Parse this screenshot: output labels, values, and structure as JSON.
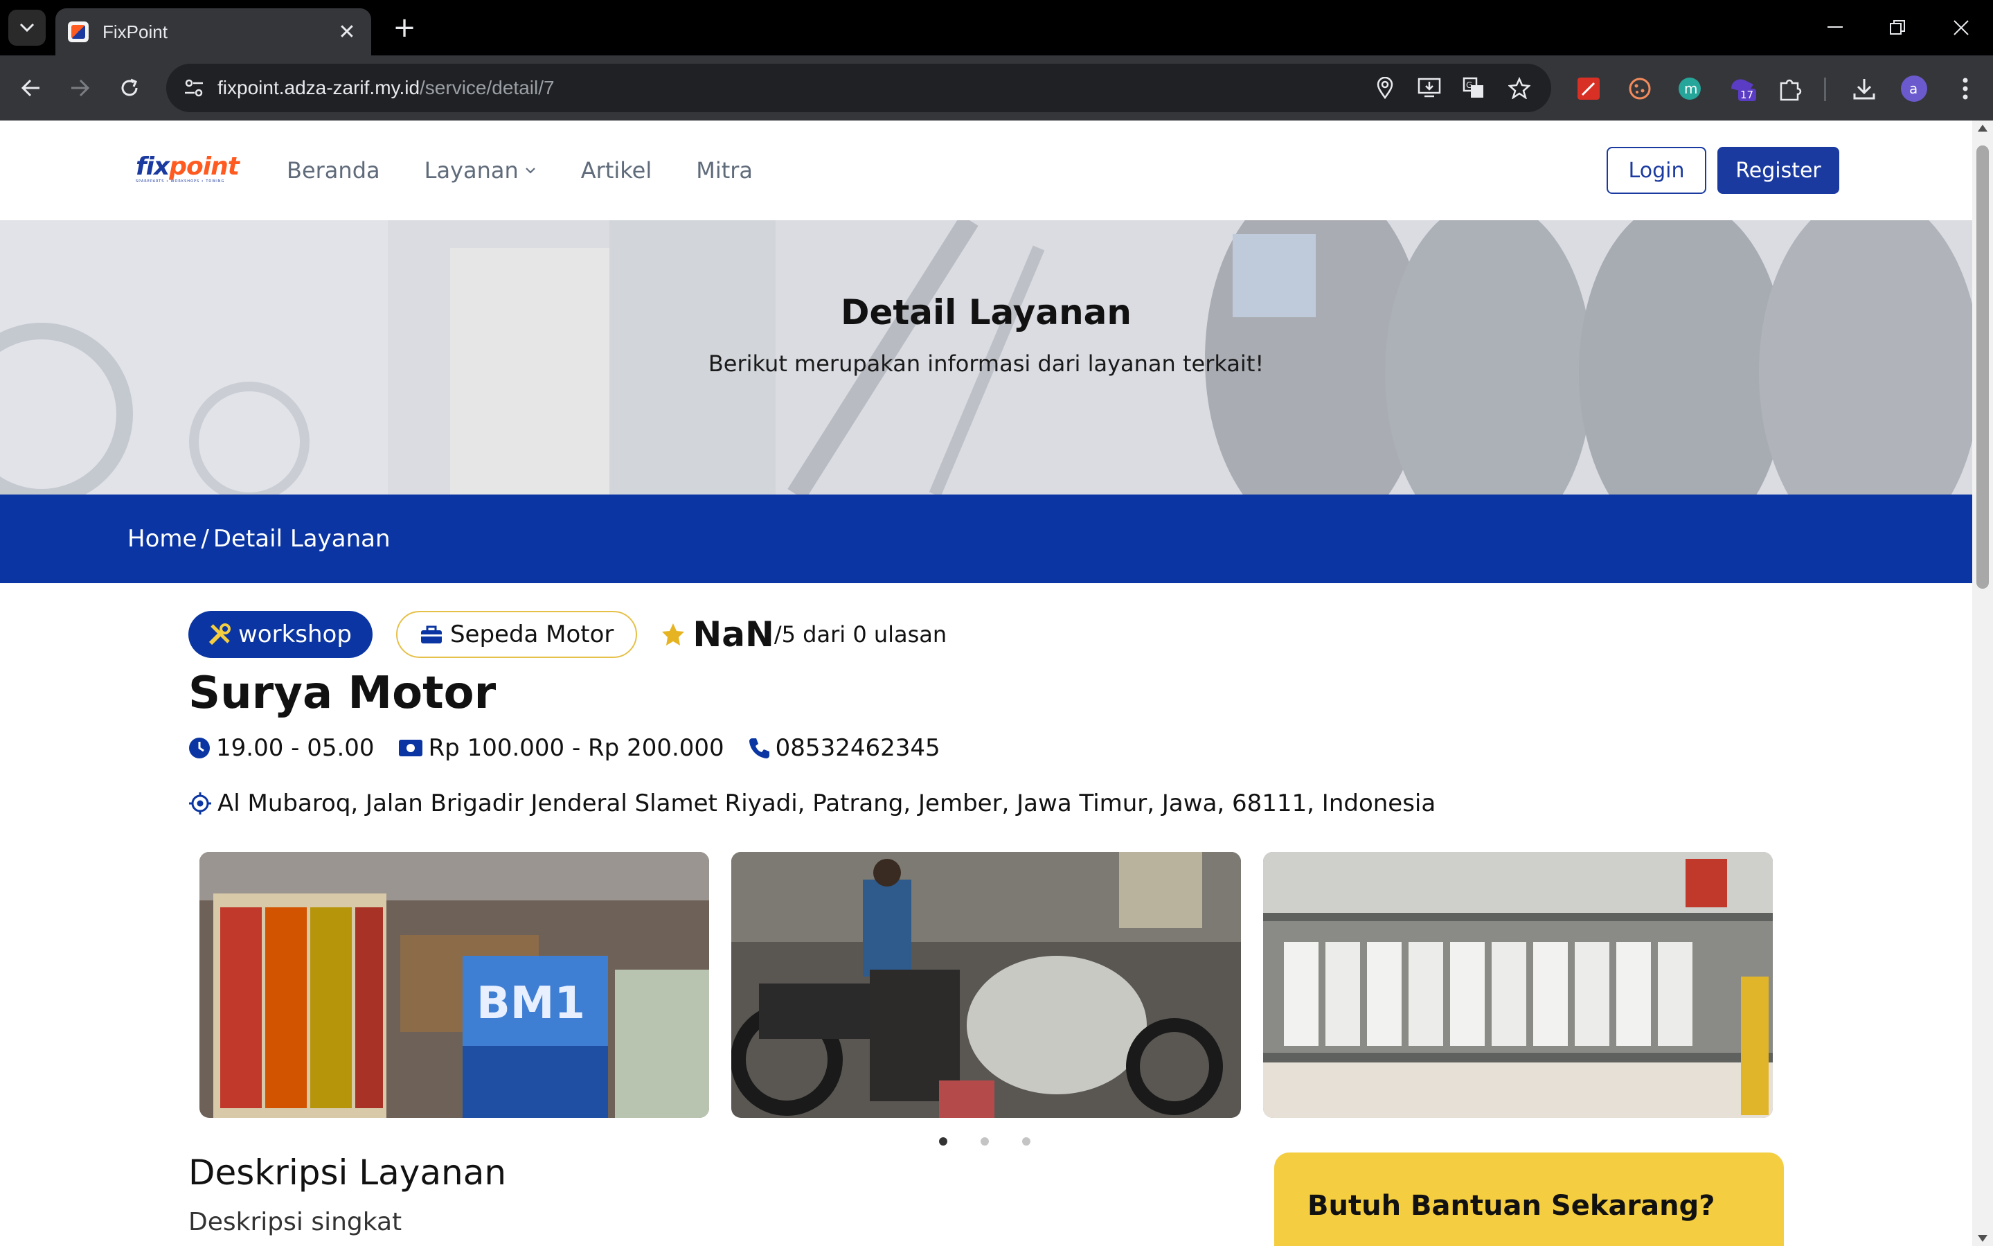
{
  "browser": {
    "tab_title": "FixPoint",
    "url_host": "fixpoint.adza-zarif.my.id",
    "url_path": "/service/detail/7",
    "extension_badge": "17",
    "profile_initial": "a",
    "extension_m_initial": "m"
  },
  "nav": {
    "logo_text_a": "fix",
    "logo_text_b": "point",
    "logo_tagline": "SPAREPARTS • WORKSHOPS • TOWING",
    "items": [
      "Beranda",
      "Layanan",
      "Artikel",
      "Mitra"
    ],
    "login": "Login",
    "register": "Register"
  },
  "hero": {
    "title": "Detail Layanan",
    "subtitle": "Berikut merupakan informasi dari layanan terkait!"
  },
  "breadcrumb": {
    "home": "Home",
    "separator": "/",
    "current": "Detail Layanan"
  },
  "service": {
    "category": "workshop",
    "vehicle": "Sepeda Motor",
    "rating_value": "NaN",
    "rating_rest": "/5 dari 0 ulasan",
    "name": "Surya Motor",
    "hours": "19.00 - 05.00",
    "price": "Rp 100.000 - Rp 200.000",
    "phone": "08532462345",
    "address": "Al Mubaroq, Jalan Brigadir Jenderal Slamet Riyadi, Patrang, Jember, Jawa Timur, Jawa, 68111, Indonesia"
  },
  "gallery": {
    "slides": 3,
    "active": 0
  },
  "description": {
    "title": "Deskripsi Layanan",
    "short": "Deskripsi singkat"
  },
  "help": {
    "title": "Butuh Bantuan Sekarang?"
  },
  "colors": {
    "primary": "#0a35a2",
    "accent": "#f4cd40",
    "logo_orange": "#ff5a1f"
  }
}
